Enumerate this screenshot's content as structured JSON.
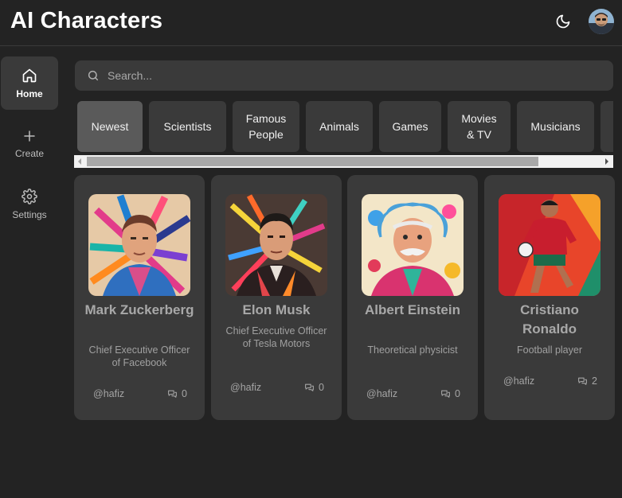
{
  "app": {
    "title": "AI Characters"
  },
  "header": {
    "theme_icon": "moon-icon",
    "avatar_icon": "user-avatar"
  },
  "sidebar": {
    "items": [
      {
        "label": "Home",
        "icon": "home-icon",
        "active": true
      },
      {
        "label": "Create",
        "icon": "plus-icon",
        "active": false
      },
      {
        "label": "Settings",
        "icon": "gear-icon",
        "active": false
      }
    ]
  },
  "search": {
    "placeholder": "Search...",
    "value": ""
  },
  "categories": [
    {
      "label": "Newest",
      "active": true
    },
    {
      "label": "Scientists",
      "active": false
    },
    {
      "label": "Famous People",
      "active": false
    },
    {
      "label": "Animals",
      "active": false
    },
    {
      "label": "Games",
      "active": false
    },
    {
      "label": "Movies & TV",
      "active": false
    },
    {
      "label": "Musicians",
      "active": false
    }
  ],
  "characters": [
    {
      "name": "Mark Zuckerberg",
      "description": "Chief Executive Officer of Facebook",
      "author": "@hafiz",
      "messages": "0"
    },
    {
      "name": "Elon Musk",
      "description": "Chief Executive Officer of Tesla Motors",
      "author": "@hafiz",
      "messages": "0"
    },
    {
      "name": "Albert Einstein",
      "description": "Theoretical physicist",
      "author": "@hafiz",
      "messages": "0"
    },
    {
      "name": "Cristiano Ronaldo",
      "description": "Football player",
      "author": "@hafiz",
      "messages": "2"
    }
  ],
  "colors": {
    "background": "#232323",
    "surface": "#3a3a3a",
    "active_chip": "#5a5a5a",
    "text": "#ffffff"
  }
}
